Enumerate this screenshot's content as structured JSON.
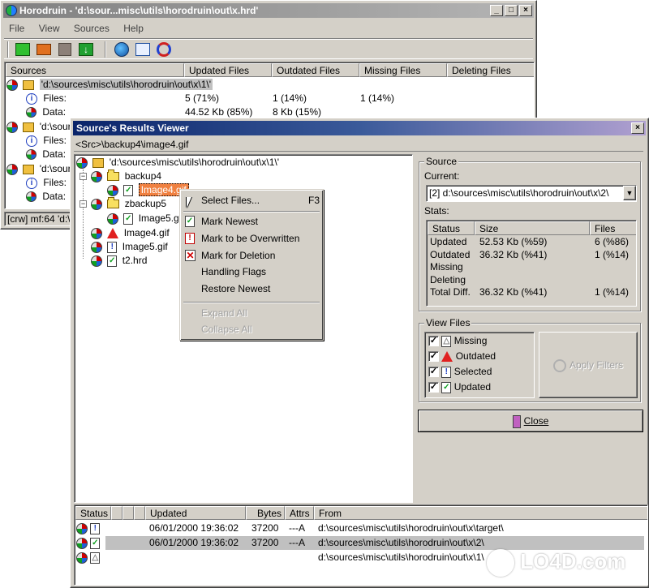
{
  "main_window": {
    "title": "Horodruin - 'd:\\sour...misc\\utils\\horodruin\\out\\x.hrd'",
    "menu": [
      "File",
      "View",
      "Sources",
      "Help"
    ],
    "toolbar_icons": [
      "add-source-icon",
      "remove-source-icon",
      "stop-icon",
      "download-icon",
      "scan-icon",
      "view-results-icon",
      "sync-icon"
    ],
    "columns": [
      "Sources",
      "Updated Files",
      "Outdated Files",
      "Missing Files",
      "Deleting Files"
    ],
    "sources": [
      {
        "path": "'d:\\sources\\misc\\utils\\horodruin\\out\\x\\1\\'",
        "files_label": "Files:",
        "data_label": "Data:",
        "files_updated": "5 (71%)",
        "files_outdated": "1 (14%)",
        "files_missing": "1 (14%)",
        "data_updated": "44.52 Kb (85%)",
        "data_outdated": "8 Kb (15%)"
      },
      {
        "path": "'d:\\sour",
        "files_label": "Files:",
        "data_label": "Data:"
      },
      {
        "path": "'d:\\sour",
        "files_label": "Files:",
        "data_label": "Data:"
      }
    ],
    "status": "[crw] mf:64 'd:\\s"
  },
  "results_viewer": {
    "title": "Source's Results Viewer",
    "path_bar": "<Src>\\backup4\\image4.gif",
    "tree": {
      "root": "'d:\\sources\\misc\\utils\\horodruin\\out\\x\\1\\'",
      "nodes": [
        {
          "label": "backup4",
          "type": "folder"
        },
        {
          "label": "Image4.gif",
          "type": "selected"
        },
        {
          "label": "zbackup5",
          "type": "folder"
        },
        {
          "label": "Image5.gif",
          "type": "file"
        },
        {
          "label": "Image4.gif",
          "type": "outdated"
        },
        {
          "label": "Image5.gif",
          "type": "selected"
        },
        {
          "label": "t2.hrd",
          "type": "updated"
        }
      ]
    },
    "context_menu": {
      "items": [
        {
          "label": "Select Files...",
          "shortcut": "F3",
          "enabled": true
        },
        {
          "label": "Mark Newest",
          "enabled": true
        },
        {
          "label": "Mark to be Overwritten",
          "enabled": true
        },
        {
          "label": "Mark for Deletion",
          "enabled": true
        },
        {
          "label": "Handling Flags",
          "enabled": true
        },
        {
          "label": "Restore Newest",
          "enabled": true
        },
        {
          "label": "Expand All",
          "enabled": false
        },
        {
          "label": "Collapse All",
          "enabled": false
        }
      ]
    },
    "source_group": {
      "label": "Source",
      "current_label": "Current:",
      "current_value": "[2]  d:\\sources\\misc\\utils\\horodruin\\out\\x\\2\\",
      "stats_label": "Stats:",
      "stats_columns": [
        "Status",
        "Size",
        "Files"
      ],
      "stats_rows": [
        {
          "status": "Updated",
          "size": "52.53 Kb (%59)",
          "files": "6 (%86)"
        },
        {
          "status": "Outdated",
          "size": "36.32 Kb (%41)",
          "files": "1 (%14)"
        },
        {
          "status": "Missing",
          "size": "",
          "files": ""
        },
        {
          "status": "Deleting",
          "size": "",
          "files": ""
        },
        {
          "status": "Total Diff.",
          "size": "36.32 Kb (%41)",
          "files": "1 (%14)"
        }
      ]
    },
    "view_files": {
      "label": "View Files",
      "options": [
        {
          "label": "Missing",
          "checked": true
        },
        {
          "label": "Outdated",
          "checked": true
        },
        {
          "label": "Selected",
          "checked": true
        },
        {
          "label": "Updated",
          "checked": true
        }
      ],
      "apply_label": "Apply Filters"
    },
    "close_label": "Close",
    "bottom_columns": [
      "Status",
      "",
      "",
      "Updated",
      "Bytes",
      "Attrs",
      "From"
    ],
    "bottom_rows": [
      {
        "updated": "06/01/2000 19:36:02",
        "bytes": "37200",
        "attrs": "---A",
        "from": "d:\\sources\\misc\\utils\\horodruin\\out\\x\\target\\"
      },
      {
        "updated": "06/01/2000 19:36:02",
        "bytes": "37200",
        "attrs": "---A",
        "from": "d:\\sources\\misc\\utils\\horodruin\\out\\x\\2\\"
      },
      {
        "updated": "",
        "bytes": "",
        "attrs": "",
        "from": "d:\\sources\\misc\\utils\\horodruin\\out\\x\\1\\"
      }
    ]
  },
  "watermark": "LO4D.com"
}
